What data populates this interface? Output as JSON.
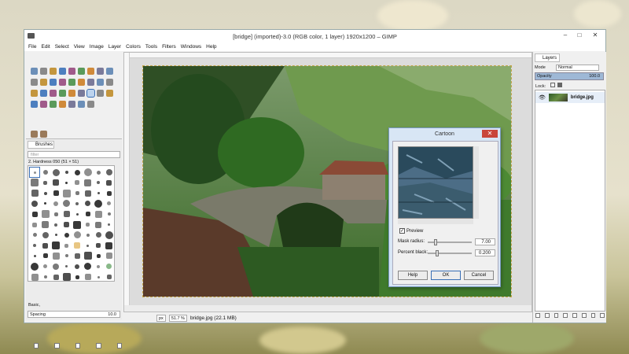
{
  "window": {
    "title": "[bridge] (imported)-3.0 (RGB color, 1 layer) 1920x1200 – GIMP",
    "controls": {
      "minimize": "–",
      "maximize": "□",
      "close": "✕"
    }
  },
  "menubar": [
    "File",
    "Edit",
    "Select",
    "View",
    "Image",
    "Layer",
    "Colors",
    "Tools",
    "Filters",
    "Windows",
    "Help"
  ],
  "brushes": {
    "tab_label": "Brushes",
    "filter_placeholder": "filter",
    "current": "2. Hardness 050 (51 × 51)",
    "tag": "Basic,",
    "spacing_label": "Spacing",
    "spacing_value": "10.0"
  },
  "status": {
    "unit": "px",
    "zoom": "51.7 %",
    "file_info": "bridge.jpg (22.1 MB)"
  },
  "layers": {
    "tab_label": "Layers",
    "mode_label": "Mode",
    "mode_value": "Normal",
    "opacity_label": "Opacity",
    "opacity_value": "100.0",
    "lock_label": "Lock:",
    "layer_name": "bridge.jpg"
  },
  "cartoon_dialog": {
    "title": "Cartoon",
    "close_label": "✕",
    "preview_label": "Preview",
    "preview_checked": true,
    "mask_radius_label": "Mask radius:",
    "mask_radius_value": "7.00",
    "mask_radius_level": 0.15,
    "percent_black_label": "Percent black:",
    "percent_black_value": "0.200",
    "percent_black_level": 0.2,
    "help_label": "Help",
    "ok_label": "OK",
    "cancel_label": "Cancel"
  },
  "icons": [
    "gimp-app-icon",
    "minimize-icon",
    "maximize-icon",
    "close-icon",
    "brush-tool-icon",
    "eye-icon"
  ],
  "colors": {
    "accent": "#3a6fb5",
    "dialog_close": "#c9453a",
    "fg_color": "#000000",
    "bg_color": "#ffffff"
  }
}
